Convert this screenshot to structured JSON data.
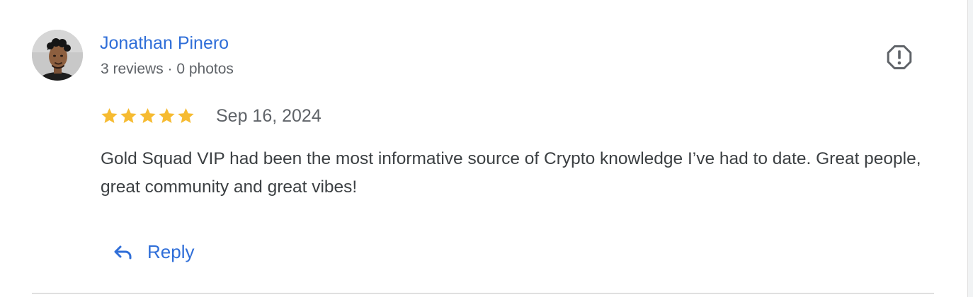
{
  "review": {
    "author": {
      "name": "Jonathan Pinero",
      "meta": "3 reviews · 0 photos"
    },
    "rating": 5,
    "rating_max": 5,
    "date": "Sep 16, 2024",
    "text": "Gold Squad VIP had been the most informative source of Crypto knowledge I’ve had to date. Great people, great community and great vibes!",
    "actions": {
      "reply_label": "Reply"
    }
  },
  "colors": {
    "link": "#2f6ed8",
    "star": "#f6bb31",
    "text": "#3c4043",
    "secondary_text": "#5f6368",
    "divider": "#e0e0e0"
  },
  "icons": {
    "report": "report-octagon-icon",
    "reply": "reply-arrow-icon",
    "star": "star-icon"
  }
}
